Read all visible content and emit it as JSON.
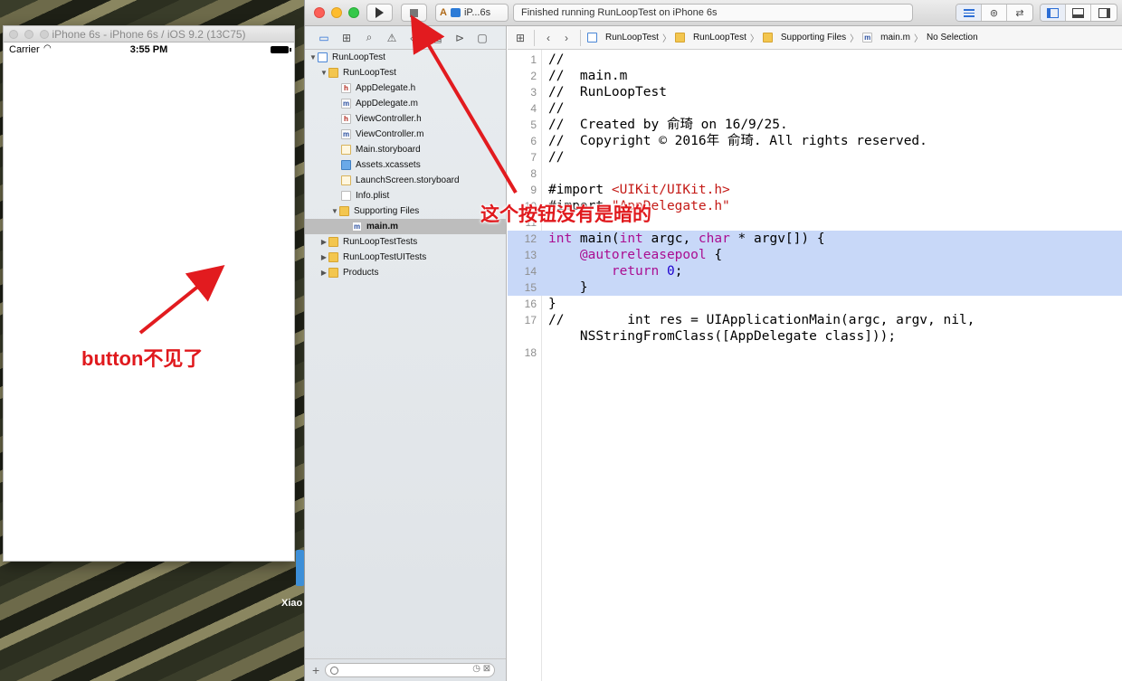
{
  "simulator": {
    "title": "iPhone 6s - iPhone 6s / iOS 9.2 (13C75)",
    "carrier": "Carrier",
    "time": "3:55 PM"
  },
  "annotations": {
    "left": "button不见了",
    "right": "这个按钮没有是暗的"
  },
  "desktop": {
    "label": "Xiao"
  },
  "xcode": {
    "toolbar": {
      "scheme_device": "iP...6s",
      "status": "Finished running RunLoopTest on iPhone 6s"
    },
    "jumpbar": {
      "crumbs": [
        "RunLoopTest",
        "RunLoopTest",
        "Supporting Files",
        "main.m",
        "No Selection"
      ]
    },
    "navigator": {
      "items": [
        {
          "label": "RunLoopTest",
          "icon": "project-icon"
        },
        {
          "label": "RunLoopTest",
          "icon": "folder-icon"
        },
        {
          "label": "AppDelegate.h",
          "icon": "header-file-icon",
          "glyph": "h"
        },
        {
          "label": "AppDelegate.m",
          "icon": "impl-file-icon",
          "glyph": "m"
        },
        {
          "label": "ViewController.h",
          "icon": "header-file-icon",
          "glyph": "h"
        },
        {
          "label": "ViewController.m",
          "icon": "impl-file-icon",
          "glyph": "m"
        },
        {
          "label": "Main.storyboard",
          "icon": "storyboard-icon"
        },
        {
          "label": "Assets.xcassets",
          "icon": "assets-icon"
        },
        {
          "label": "LaunchScreen.storyboard",
          "icon": "storyboard-icon"
        },
        {
          "label": "Info.plist",
          "icon": "plist-icon"
        },
        {
          "label": "Supporting Files",
          "icon": "folder-icon"
        },
        {
          "label": "main.m",
          "icon": "impl-file-icon",
          "glyph": "m"
        },
        {
          "label": "RunLoopTestTests",
          "icon": "folder-icon"
        },
        {
          "label": "RunLoopTestUITests",
          "icon": "folder-icon"
        },
        {
          "label": "Products",
          "icon": "folder-icon"
        }
      ]
    },
    "code": {
      "lines": [
        {
          "n": "1",
          "text": "//"
        },
        {
          "n": "2",
          "text": "//  main.m"
        },
        {
          "n": "3",
          "text": "//  RunLoopTest"
        },
        {
          "n": "4",
          "text": "//"
        },
        {
          "n": "5",
          "text": "//  Created by 俞琦 on 16/9/25."
        },
        {
          "n": "6",
          "text": "//  Copyright © 2016年 俞琦. All rights reserved."
        },
        {
          "n": "7",
          "text": "//"
        },
        {
          "n": "8",
          "text": ""
        },
        {
          "n": "9",
          "text": "#import <UIKit/UIKit.h>"
        },
        {
          "n": "10",
          "text": "#import \"AppDelegate.h\""
        },
        {
          "n": "11",
          "text": ""
        },
        {
          "n": "12",
          "text": "int main(int argc, char * argv[]) {"
        },
        {
          "n": "13",
          "text": "    @autoreleasepool {"
        },
        {
          "n": "14",
          "text": "        return 0;"
        },
        {
          "n": "15",
          "text": "    }"
        },
        {
          "n": "16",
          "text": "}"
        },
        {
          "n": "17",
          "text": "//        int res = UIApplicationMain(argc, argv, nil,"
        },
        {
          "n": "",
          "text": "    NSStringFromClass([AppDelegate class]));"
        },
        {
          "n": "18",
          "text": ""
        }
      ]
    }
  }
}
